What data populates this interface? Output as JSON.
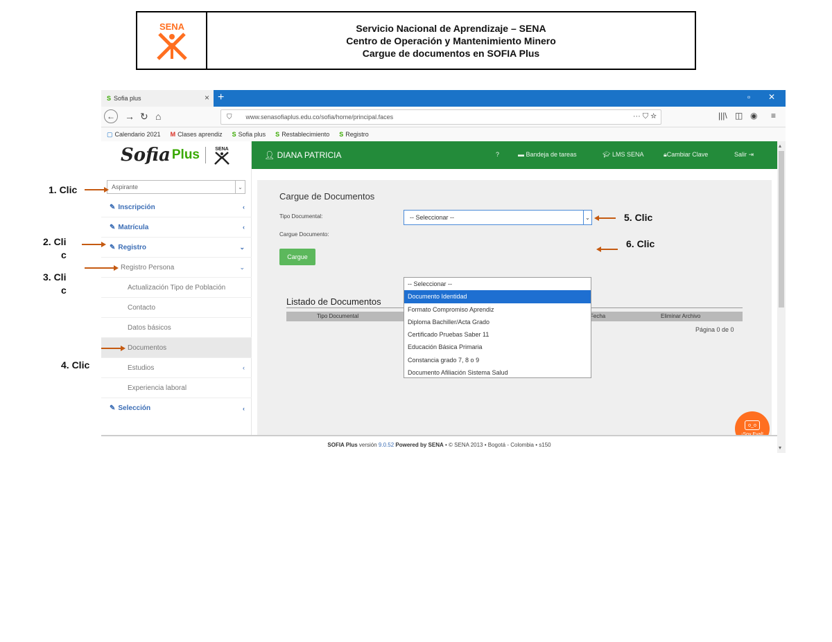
{
  "document": {
    "title_line1": "Servicio Nacional de Aprendizaje – SENA",
    "title_line2": "Centro de Operación y Mantenimiento Minero",
    "title_line3": "Cargue de documentos en SOFIA Plus",
    "logo_text": "SENA"
  },
  "browser": {
    "tab_label": "Sofia plus",
    "url": "www.senasofiaplus.edu.co/sofia/home/principal.faces",
    "url_icons": "··· ⛉ ☆",
    "bookmarks": [
      "Calendario 2021",
      "Clases aprendiz",
      "Sofia plus",
      "Restablecimiento",
      "Registro"
    ]
  },
  "app": {
    "brand_sofia": "Sofia",
    "brand_plus": "Plus",
    "brand_sena": "SENA",
    "user_name": "DIANA PATRICIA",
    "top_links": [
      "Bandeja de tareas",
      "LMS SENA",
      "Cambiar Clave",
      "Salir"
    ],
    "role_select_value": "Aspirante",
    "menu": {
      "inscripcion": "Inscripción",
      "matricula": "Matrícula",
      "registro": "Registro",
      "registro_persona": "Registro Persona",
      "actualizacion": "Actualización Tipo de Población",
      "contacto": "Contacto",
      "datos_basicos": "Datos básicos",
      "documentos": "Documentos",
      "estudios": "Estudios",
      "experiencia": "Experiencia laboral",
      "seleccion": "Selección"
    },
    "panel_title": "Cargue de Documentos",
    "tipo_label": "Tipo Documental:",
    "cargue_label": "Cargue Documento:",
    "tipo_value": "-- Seleccionar --",
    "cargue_button": "Cargue",
    "listado_title": "Listado de Documentos",
    "table_headers": [
      "Tipo Documental",
      "Fecha",
      "Eliminar Archivo"
    ],
    "pager": "Página 0 de 0",
    "dropdown_options": [
      "-- Seleccionar --",
      "Documento Identidad",
      "Formato Compromiso Aprendiz",
      "Diploma Bachiller/Acta Grado",
      "Certificado Pruebas Saber 11",
      "Educación Básica Primaria",
      "Constancia grado 7, 8 o 9",
      "Documento Afiliación Sistema Salud"
    ],
    "highlighted_option": 1,
    "eval_badge": "¡Soy Eval!",
    "footer_brand": "SOFIA Plus",
    "footer_version_prefix": "versión",
    "footer_version": "9.0.52",
    "footer_powered": "Powered by SENA",
    "footer_rest": "• © SENA 2013 • Bogotá - Colombia • s150"
  },
  "annotations": {
    "a1": "1. Clic",
    "a2_line1": "2.  Cli",
    "a2_line2": "c",
    "a3_line1": "3.  Cli",
    "a3_line2": "c",
    "a4": "4. Clic",
    "a5": "5.  Clic",
    "a6": "6.  Clic"
  },
  "colors": {
    "accent_green": "#238b3a",
    "arrow_orange": "#c55a11",
    "sena_orange": "#ff6f20",
    "browser_blue": "#1a73c8",
    "highlight_blue": "#1e6fd1"
  }
}
